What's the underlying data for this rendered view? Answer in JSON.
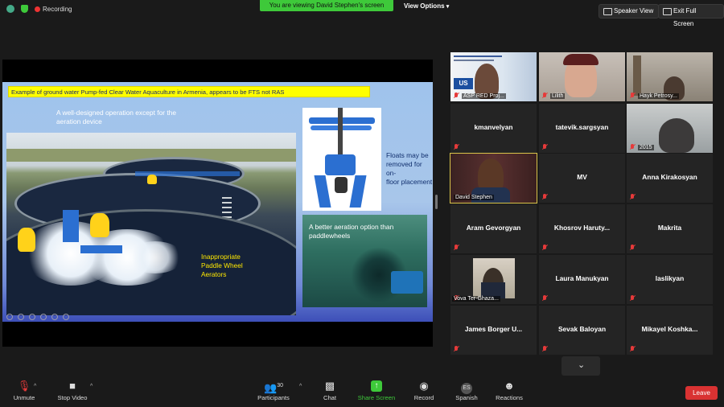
{
  "top_bar": {
    "recording_label": "Recording",
    "viewing_banner": "You are viewing David Stephen's screen",
    "view_options": "View Options",
    "speaker_view": "Speaker View",
    "exit_full_screen": "Exit Full Screen"
  },
  "slide": {
    "title": "Example of ground water Pump-fed Clear Water Aquaculture in Armenia, appears to be FTS not RAS",
    "caption_top_line1": "A well-designed operation except for the",
    "caption_top_line2": "aeration device",
    "caption_floats_line1": "Floats may be",
    "caption_floats_line2": "removed for on-",
    "caption_floats_line3": "floor placement",
    "caption_better_line1": "A better aeration option than",
    "caption_better_line2": "paddlewheels",
    "caption_bad_line1": "Inappropriate",
    "caption_bad_line2": "Paddle Wheel",
    "caption_bad_line3": "Aerators"
  },
  "gallery": {
    "tiles": [
      {
        "name": "ASP RED Proj..."
      },
      {
        "name": "Lilith"
      },
      {
        "name": "Hayk Petrosy..."
      },
      {
        "name": "kmanvelyan"
      },
      {
        "name": "tatevik.sargsyan"
      },
      {
        "name": "2015"
      },
      {
        "name": "David Stephen"
      },
      {
        "name": "MV"
      },
      {
        "name": "Anna Kirakosyan"
      },
      {
        "name": "Aram Gevorgyan"
      },
      {
        "name": "Khosrov Haruty..."
      },
      {
        "name": "Makrita"
      },
      {
        "name": "Vova Ter-Ghaza..."
      },
      {
        "name": "Laura Manukyan"
      },
      {
        "name": "laslikyan"
      },
      {
        "name": "James Borger U..."
      },
      {
        "name": "Sevak Baloyan"
      },
      {
        "name": "Mikayel Koshka..."
      }
    ]
  },
  "bottom_bar": {
    "unmute": "Unmute",
    "stop_video": "Stop Video",
    "participants": "Participants",
    "participants_count": "30",
    "chat": "Chat",
    "share_screen": "Share Screen",
    "record": "Record",
    "spanish": "Spanish",
    "spanish_badge": "ES",
    "reactions": "Reactions",
    "leave": "Leave"
  },
  "colors": {
    "banner_green": "#3ec93a",
    "leave_red": "#d93232",
    "active_speaker_outline": "#d9c44a",
    "slide_title_yellow": "#ffff00"
  }
}
